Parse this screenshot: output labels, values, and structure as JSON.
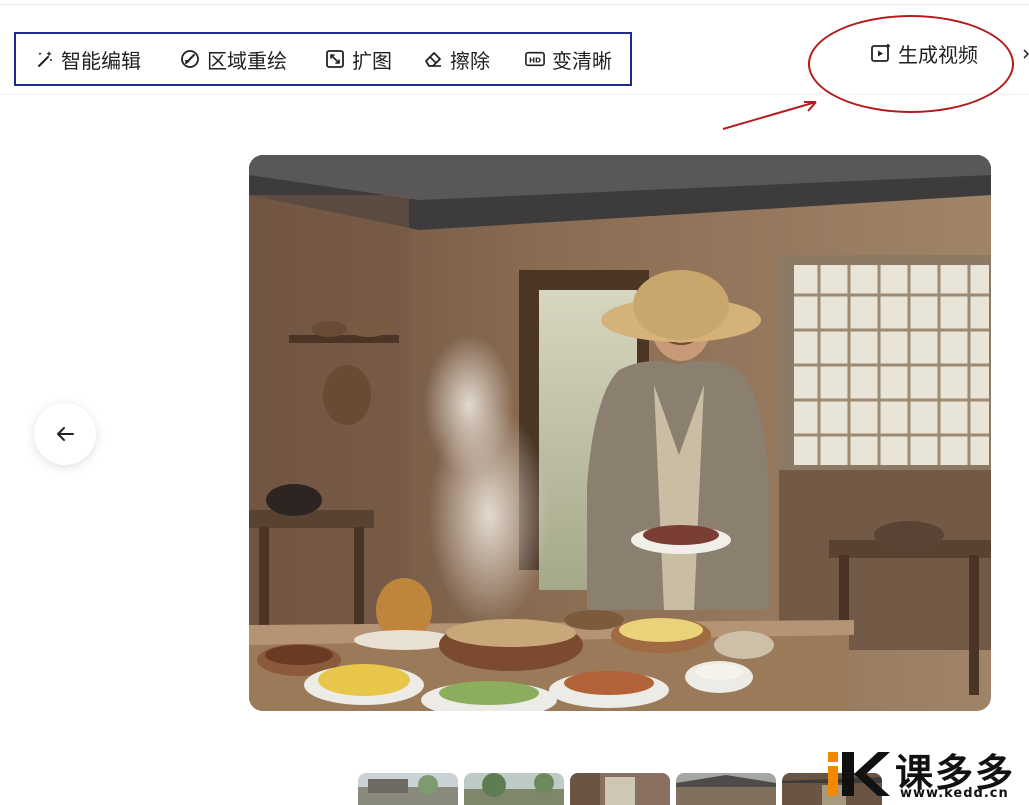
{
  "toolbar": {
    "tools": [
      {
        "label": "智能编辑",
        "icon": "magic-wand-icon"
      },
      {
        "label": "区域重绘",
        "icon": "brush-icon"
      },
      {
        "label": "扩图",
        "icon": "expand-icon"
      },
      {
        "label": "擦除",
        "icon": "eraser-icon"
      },
      {
        "label": "变清晰",
        "icon": "hd-icon"
      }
    ],
    "generate_video": {
      "label": "生成视频",
      "icon": "video-play-icon"
    },
    "highlight_color": "#1f2a8a"
  },
  "annotation": {
    "color": "#b21c1c"
  },
  "navigation": {
    "back_icon": "arrow-left-icon"
  },
  "gallery": {
    "thumbnail_count": 5
  },
  "watermark": {
    "brand": "课多多",
    "url": "www.kedd.cn",
    "accent_color": "#f28a00"
  }
}
